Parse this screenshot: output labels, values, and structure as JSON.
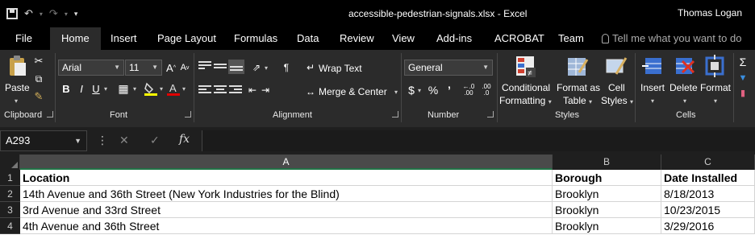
{
  "window": {
    "title": "accessible-pedestrian-signals.xlsx  -  Excel",
    "user": "Thomas Logan"
  },
  "tabs": [
    {
      "label": "File"
    },
    {
      "label": "Home"
    },
    {
      "label": "Insert"
    },
    {
      "label": "Page Layout"
    },
    {
      "label": "Formulas"
    },
    {
      "label": "Data"
    },
    {
      "label": "Review"
    },
    {
      "label": "View"
    },
    {
      "label": "Add-ins"
    },
    {
      "label": "ACROBAT"
    },
    {
      "label": "Team"
    }
  ],
  "tell_me": "Tell me what you want to do",
  "ribbon": {
    "clipboard": {
      "paste": "Paste",
      "label": "Clipboard"
    },
    "font": {
      "name": "Arial",
      "size": "11",
      "label": "Font",
      "grow": "A",
      "shrink": "A",
      "bold": "B",
      "italic": "I",
      "underline": "U"
    },
    "alignment": {
      "wrap_text": "Wrap Text",
      "merge_center": "Merge & Center",
      "label": "Alignment"
    },
    "number": {
      "format": "General",
      "currency": "$",
      "percent": "%",
      "comma": "’",
      "inc_decimal": ".00",
      "dec_decimal": ".0",
      "label": "Number"
    },
    "styles": {
      "conditional_1": "Conditional",
      "conditional_2": "Formatting",
      "format_table_1": "Format as",
      "format_table_2": "Table",
      "cell_styles_1": "Cell",
      "cell_styles_2": "Styles",
      "label": "Styles"
    },
    "cells": {
      "insert": "Insert",
      "delete": "Delete",
      "format": "Format",
      "label": "Cells"
    }
  },
  "formula_bar": {
    "name_box": "A293",
    "fx": "fx",
    "content": ""
  },
  "columns": [
    {
      "letter": "A",
      "selected": true
    },
    {
      "letter": "B",
      "selected": false
    },
    {
      "letter": "C",
      "selected": false
    }
  ],
  "rows": [
    {
      "num": "1",
      "cells": [
        "Location",
        "Borough",
        "Date Installed"
      ]
    },
    {
      "num": "2",
      "cells": [
        "14th Avenue and 36th Street (New York Industries for the Blind)",
        "Brooklyn",
        "8/18/2013"
      ]
    },
    {
      "num": "3",
      "cells": [
        "3rd Avenue and 33rd Street",
        "Brooklyn",
        "10/23/2015"
      ]
    },
    {
      "num": "4",
      "cells": [
        "4th Avenue and 36th Street",
        "Brooklyn",
        "3/29/2016"
      ]
    }
  ],
  "colors": {
    "accent": "#217346",
    "ribbon_bg": "#2b2b2b",
    "title_bg": "#000000"
  }
}
